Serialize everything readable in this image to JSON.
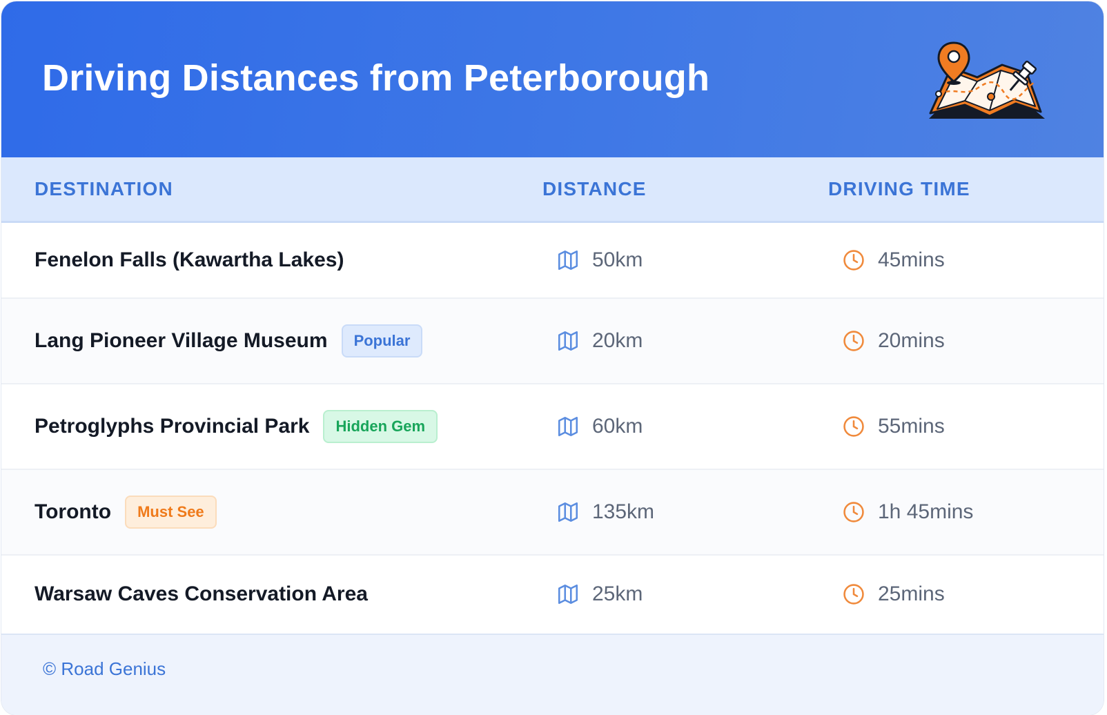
{
  "header": {
    "title": "Driving Distances from Peterborough",
    "illustration": "map-with-pins-icon",
    "gradient_start": "#2f6be8",
    "gradient_end": "#4f82e2"
  },
  "table": {
    "columns": [
      "DESTINATION",
      "DISTANCE",
      "DRIVING TIME"
    ],
    "rows": [
      {
        "destination": "Fenelon Falls (Kawartha Lakes)",
        "badge": "",
        "distance": "50km",
        "time": "45mins"
      },
      {
        "destination": "Lang Pioneer Village Museum",
        "badge": "Popular",
        "distance": "20km",
        "time": "20mins"
      },
      {
        "destination": "Petroglyphs Provincial Park",
        "badge": "Hidden Gem",
        "distance": "60km",
        "time": "55mins"
      },
      {
        "destination": "Toronto",
        "badge": "Must See",
        "distance": "135km",
        "time": "1h 45mins"
      },
      {
        "destination": "Warsaw Caves Conservation Area",
        "badge": "",
        "distance": "25km",
        "time": "25mins"
      }
    ],
    "distance_icon": "map-icon",
    "time_icon": "clock-icon",
    "badge_colors": {
      "Popular": "#3b74d6",
      "Hidden Gem": "#18a55a",
      "Must See": "#ef7a1a"
    }
  },
  "footer": {
    "text": "© Road Genius"
  }
}
